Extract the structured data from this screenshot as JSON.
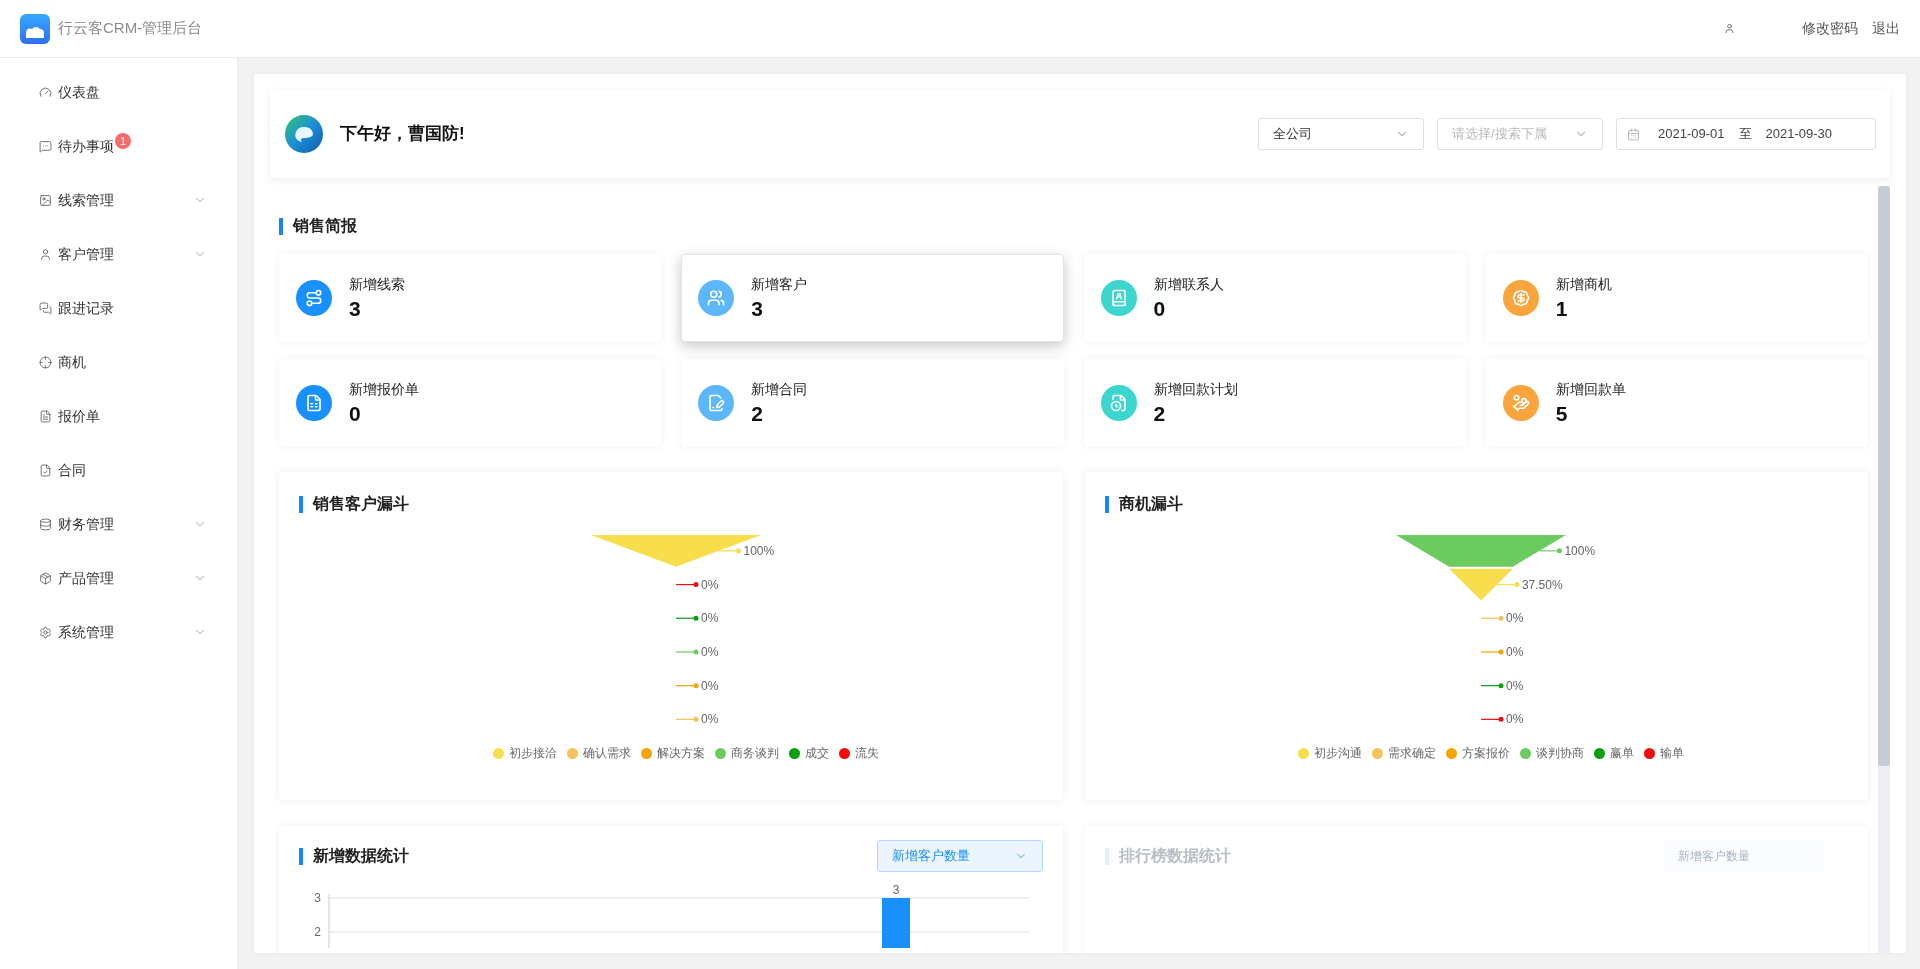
{
  "app": {
    "title": "行云客CRM-管理后台"
  },
  "header": {
    "links": [
      "修改密码",
      "退出"
    ]
  },
  "sidebar": {
    "items": [
      {
        "label": "仪表盘",
        "kind": "link"
      },
      {
        "label": "待办事项",
        "kind": "link",
        "badge": "1"
      },
      {
        "label": "线索管理",
        "kind": "group"
      },
      {
        "label": "客户管理",
        "kind": "group"
      },
      {
        "label": "跟进记录",
        "kind": "link"
      },
      {
        "label": "商机",
        "kind": "link"
      },
      {
        "label": "报价单",
        "kind": "link"
      },
      {
        "label": "合同",
        "kind": "link"
      },
      {
        "label": "财务管理",
        "kind": "group"
      },
      {
        "label": "产品管理",
        "kind": "group"
      },
      {
        "label": "系统管理",
        "kind": "group"
      }
    ]
  },
  "greeting": {
    "text": "下午好，曹国防!",
    "company_select": {
      "value": "全公司"
    },
    "subordinate_select": {
      "placeholder": "请选择/搜索下属"
    },
    "date_range": {
      "start": "2021-09-01",
      "separator": "至",
      "end": "2021-09-30"
    }
  },
  "summary": {
    "title": "销售简报",
    "cards": [
      {
        "label": "新增线索",
        "value": "3",
        "color": "#1890ff",
        "selected": false
      },
      {
        "label": "新增客户",
        "value": "3",
        "color": "#5cb8fa",
        "selected": true
      },
      {
        "label": "新增联系人",
        "value": "0",
        "color": "#3dd6cf",
        "selected": false
      },
      {
        "label": "新增商机",
        "value": "1",
        "color": "#f9a43d",
        "selected": false
      },
      {
        "label": "新增报价单",
        "value": "0",
        "color": "#1890ff",
        "selected": false
      },
      {
        "label": "新增合同",
        "value": "2",
        "color": "#5cb8fa",
        "selected": false
      },
      {
        "label": "新增回款计划",
        "value": "2",
        "color": "#3dd6cf",
        "selected": false
      },
      {
        "label": "新增回款单",
        "value": "5",
        "color": "#f9a43d",
        "selected": false
      }
    ]
  },
  "funnels": [
    {
      "title": "销售客户漏斗",
      "stages": [
        {
          "label": "100%",
          "color": "#f8dd4c"
        },
        {
          "label": "0%",
          "color": "#f50a0a"
        },
        {
          "label": "0%",
          "color": "#06a10d"
        },
        {
          "label": "0%",
          "color": "#6ccb5f"
        },
        {
          "label": "0%",
          "color": "#f7a400"
        },
        {
          "label": "0%",
          "color": "#f6c25a"
        }
      ],
      "legend": [
        {
          "label": "初步接洽",
          "color": "#f8dd4c"
        },
        {
          "label": "确认需求",
          "color": "#f6c25a"
        },
        {
          "label": "解决方案",
          "color": "#f7a400"
        },
        {
          "label": "商务谈判",
          "color": "#6ccb5f"
        },
        {
          "label": "成交",
          "color": "#06a10d"
        },
        {
          "label": "流失",
          "color": "#f50a0a"
        }
      ]
    },
    {
      "title": "商机漏斗",
      "stages": [
        {
          "label": "100%",
          "color": "#6ccb5f"
        },
        {
          "label": "37.50%",
          "color": "#f8dd4c"
        },
        {
          "label": "0%",
          "color": "#f6c25a"
        },
        {
          "label": "0%",
          "color": "#f7a400"
        },
        {
          "label": "0%",
          "color": "#06a10d"
        },
        {
          "label": "0%",
          "color": "#f50a0a"
        }
      ],
      "legend": [
        {
          "label": "初步沟通",
          "color": "#f8dd4c"
        },
        {
          "label": "需求确定",
          "color": "#f6c25a"
        },
        {
          "label": "方案报价",
          "color": "#f7a400"
        },
        {
          "label": "谈判协商",
          "color": "#6ccb5f"
        },
        {
          "label": "赢单",
          "color": "#06a10d"
        },
        {
          "label": "输单",
          "color": "#f50a0a"
        }
      ]
    }
  ],
  "stats": {
    "title": "新增数据统计",
    "metric_select": {
      "value": "新增客户数量"
    },
    "axis_labels": [
      "3",
      "2"
    ],
    "bar_label": "3"
  },
  "ranking": {
    "title": "排行榜数据统计",
    "metric_select": {
      "value": "新增客户数量"
    }
  }
}
